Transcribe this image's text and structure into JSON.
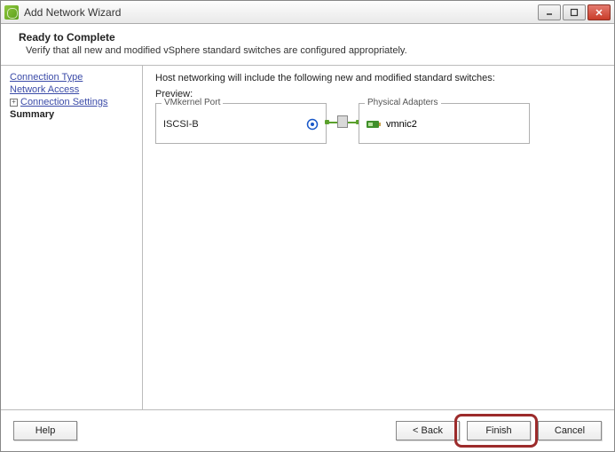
{
  "window": {
    "title": "Add Network Wizard"
  },
  "header": {
    "title": "Ready to Complete",
    "subtitle": "Verify that all new and modified vSphere standard switches are configured appropriately."
  },
  "sidebar": {
    "items": [
      {
        "label": "Connection Type"
      },
      {
        "label": "Network Access"
      },
      {
        "label": "Connection Settings",
        "expandable": true
      },
      {
        "label": "Summary",
        "current": true
      }
    ]
  },
  "main": {
    "instruction": "Host networking will include the following new and modified standard switches:",
    "preview_label": "Preview:",
    "vmkernel_group_label": "VMkernel Port",
    "vmkernel_name": "ISCSI-B",
    "physical_group_label": "Physical Adapters",
    "physical_adapter": "vmnic2"
  },
  "footer": {
    "help": "Help",
    "back": "< Back",
    "finish": "Finish",
    "cancel": "Cancel"
  }
}
